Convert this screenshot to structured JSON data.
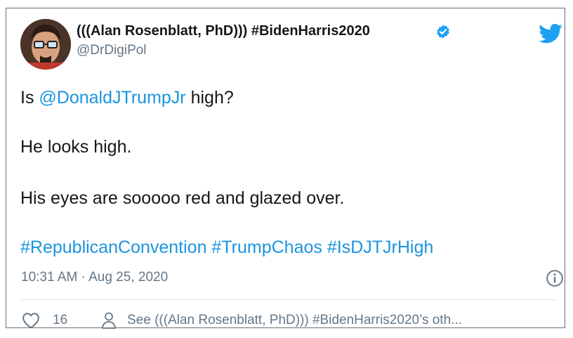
{
  "author": {
    "display_name": "(((Alan Rosenblatt, PhD))) #BidenHarris2020",
    "handle": "@DrDigiPol"
  },
  "tweet": {
    "line1_prefix": "Is ",
    "line1_mention": "@DonaldJTrumpJr",
    "line1_suffix": " high?",
    "line2": "He looks high.",
    "line3": "His eyes are sooooo red and glazed over.",
    "hashtags": [
      "#RepublicanConvention",
      "#TrumpChaos",
      "#IsDJTJrHigh"
    ],
    "timestamp": "10:31 AM · Aug 25, 2020"
  },
  "actions": {
    "likes": "16",
    "see_more": "See (((Alan Rosenblatt, PhD))) #BidenHarris2020’s oth..."
  },
  "icons": {
    "verified": "verified-badge-icon",
    "brand": "twitter-bird-icon",
    "info": "info-icon",
    "like": "heart-icon",
    "profile": "person-icon"
  },
  "colors": {
    "link": "#1b95e0",
    "muted": "#657786",
    "twitter_blue": "#1da1f2"
  }
}
